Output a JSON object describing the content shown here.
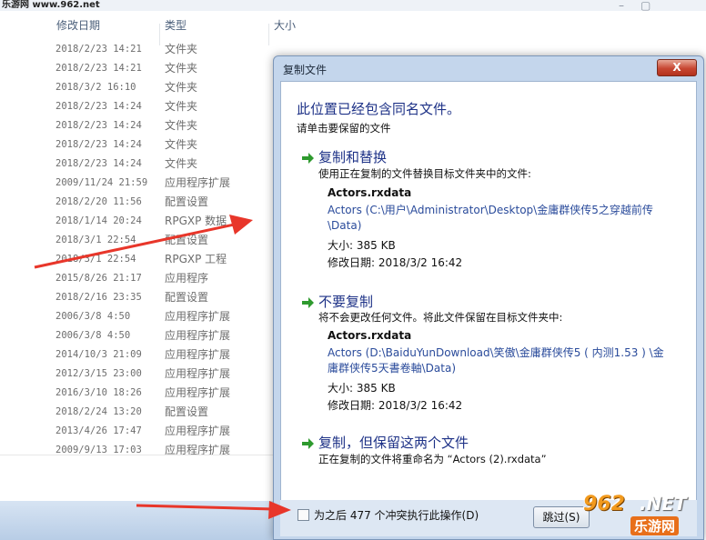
{
  "watermark": "乐游网 www.962.net",
  "explorer": {
    "columns": {
      "date": "修改日期",
      "type": "类型",
      "size": "大小"
    },
    "rows": [
      {
        "date": "2018/2/23 14:21",
        "type": "文件夹"
      },
      {
        "date": "2018/2/23 14:21",
        "type": "文件夹"
      },
      {
        "date": "2018/3/2 16:10",
        "type": "文件夹"
      },
      {
        "date": "2018/2/23 14:24",
        "type": "文件夹"
      },
      {
        "date": "2018/2/23 14:24",
        "type": "文件夹"
      },
      {
        "date": "2018/2/23 14:24",
        "type": "文件夹"
      },
      {
        "date": "2018/2/23 14:24",
        "type": "文件夹"
      },
      {
        "date": "2009/11/24 21:59",
        "type": "应用程序扩展"
      },
      {
        "date": "2018/2/20 11:56",
        "type": "配置设置"
      },
      {
        "date": "2018/1/14 20:24",
        "type": "RPGXP 数据"
      },
      {
        "date": "2018/3/1 22:54",
        "type": "配置设置"
      },
      {
        "date": "2018/3/1 22:54",
        "type": "RPGXP 工程"
      },
      {
        "date": "2015/8/26 21:17",
        "type": "应用程序"
      },
      {
        "date": "2018/2/16 23:35",
        "type": "配置设置"
      },
      {
        "date": "2006/3/8 4:50",
        "type": "应用程序扩展"
      },
      {
        "date": "2006/3/8 4:50",
        "type": "应用程序扩展"
      },
      {
        "date": "2014/10/3 21:09",
        "type": "应用程序扩展"
      },
      {
        "date": "2012/3/15 23:00",
        "type": "应用程序扩展"
      },
      {
        "date": "2016/3/10 18:26",
        "type": "应用程序扩展"
      },
      {
        "date": "2018/2/24 13:20",
        "type": "配置设置"
      },
      {
        "date": "2013/4/26 17:47",
        "type": "应用程序扩展"
      },
      {
        "date": "2009/9/13 17:03",
        "type": "应用程序扩展"
      }
    ]
  },
  "dialog": {
    "title": "复制文件",
    "close_label": "X",
    "main_instruction": "此位置已经包含同名文件。",
    "sub_instruction": "请单击要保留的文件",
    "options": [
      {
        "title": "复制和替换",
        "desc": "使用正在复制的文件替换目标文件夹中的文件:",
        "file_name": "Actors.rxdata",
        "path": "Actors (C:\\用户\\Administrator\\Desktop\\金庸群侠传5之穿越前传\\Data)",
        "size": "大小: 385 KB",
        "modified": "修改日期: 2018/3/2 16:42"
      },
      {
        "title": "不要复制",
        "desc": "将不会更改任何文件。将此文件保留在目标文件夹中:",
        "file_name": "Actors.rxdata",
        "path": "Actors (D:\\BaiduYunDownload\\笑傲\\金庸群侠传5 ( 内测1.53 ) \\金庸群侠传5天書卷軸\\Data)",
        "size": "大小: 385 KB",
        "modified": "修改日期: 2018/3/2 16:42"
      },
      {
        "title": "复制，但保留这两个文件",
        "desc": "正在复制的文件将重命名为 “Actors (2).rxdata”"
      }
    ],
    "checkbox_label": "为之后 477 个冲突执行此操作(D)",
    "skip_label": "跳过(S)"
  },
  "logo": {
    "number": "962",
    "net": ".NET",
    "cn": "乐游网"
  },
  "colors": {
    "link_blue": "#1e3287",
    "path_blue": "#2a4b9b",
    "arrow_red": "#e8362a",
    "arrow_green": "#2e9a2e"
  }
}
